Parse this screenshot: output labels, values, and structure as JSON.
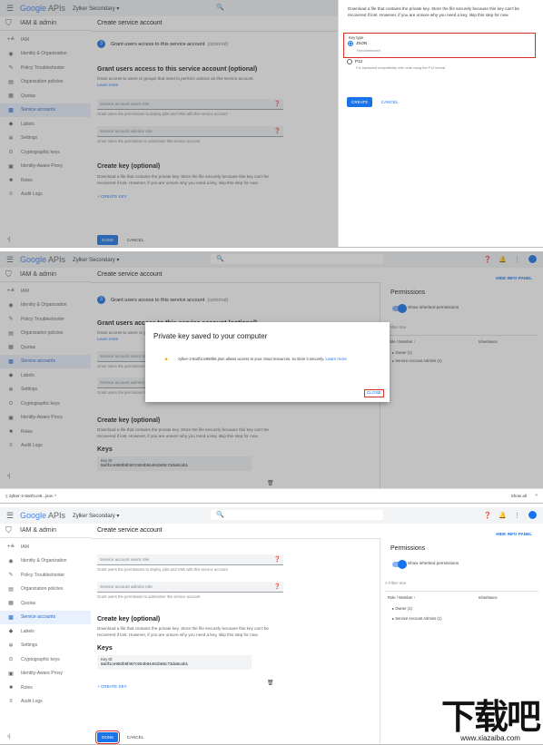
{
  "app": {
    "logo_google": "Google",
    "logo_apis": " APIs",
    "project": "Zylker Secondary",
    "search_icon": "🔍",
    "title": "IAM & admin",
    "page_title": "Create service account"
  },
  "sidebar": {
    "items": [
      {
        "label": "IAM",
        "icon": "person-add-icon"
      },
      {
        "label": "Identity & Organization",
        "icon": "account-circle-icon"
      },
      {
        "label": "Policy Troubleshooter",
        "icon": "wrench-icon"
      },
      {
        "label": "Organization policies",
        "icon": "doc-icon"
      },
      {
        "label": "Quotas",
        "icon": "table-icon"
      },
      {
        "label": "Service accounts",
        "icon": "service-account-icon"
      },
      {
        "label": "Labels",
        "icon": "tag-icon"
      },
      {
        "label": "Settings",
        "icon": "gear-icon"
      },
      {
        "label": "Cryptographic keys",
        "icon": "shield-icon"
      },
      {
        "label": "Identity-Aware Proxy",
        "icon": "proxy-icon"
      },
      {
        "label": "Roles",
        "icon": "hat-icon"
      },
      {
        "label": "Audit Logs",
        "icon": "list-icon"
      }
    ]
  },
  "step3": {
    "num": "3",
    "label": "Grant users access to this service account",
    "optional": "(optional)"
  },
  "grant": {
    "heading": "Grant users access to this service account (optional)",
    "desc": "Grant access to users or groups that need to perform actions as this service account.",
    "learn_more": "Learn more",
    "users_role": "Service account users role",
    "users_hint": "Grant users the permissions to deploy jobs and VMs with this service account",
    "admins_role": "Service account admins role",
    "admins_hint": "Grant users the permission to administer this service account"
  },
  "createkey": {
    "heading": "Create key (optional)",
    "desc": "Download a file that contains the private key. Store the file securely because this key can't be recovered if lost. However, if you are unsure why you need a key, skip this step for now.",
    "add": "+ CREATE KEY"
  },
  "keys": {
    "heading": "Keys",
    "key_id_label": "Key ID",
    "key_id": "8a0f1ce950b6f467c504b94461b65c73da5cab1"
  },
  "actions": {
    "done": "DONE",
    "cancel": "CANCEL",
    "create": "CREATE"
  },
  "keypanel": {
    "desc": "Download a file that contains the private key. Store the file securely because this key can't be recovered if lost. However, if you are unsure why you need a key, skip this step for now.",
    "key_type": "Key type",
    "json": "JSON",
    "recommended": "Recommended",
    "p12": "P12",
    "p12_desc": "For backward compatibility with code using the P12 format"
  },
  "permissions": {
    "title": "Permissions",
    "hide": "HIDE INFO PANEL",
    "show_inherited": "Show inherited permissions",
    "filter": "Filter tree",
    "role_member": "Role / Member",
    "inheritance": "Inheritance",
    "owner": "Owner (1)",
    "sa_admin": "Service Account Admins (1)"
  },
  "dialog": {
    "title": "Private key saved to your computer",
    "message": "zylker-2-8a0f1ce950b6.json allows access to your cloud resources, so store it securely.",
    "learn_more": "Learn more",
    "close": "CLOSE"
  },
  "downloads": {
    "file": "zylker-2-8a0f1ce9...json",
    "show_all": "Show all",
    "close": "×"
  },
  "watermark": {
    "text": "下载吧",
    "url": "www.xiazaiba.com"
  }
}
